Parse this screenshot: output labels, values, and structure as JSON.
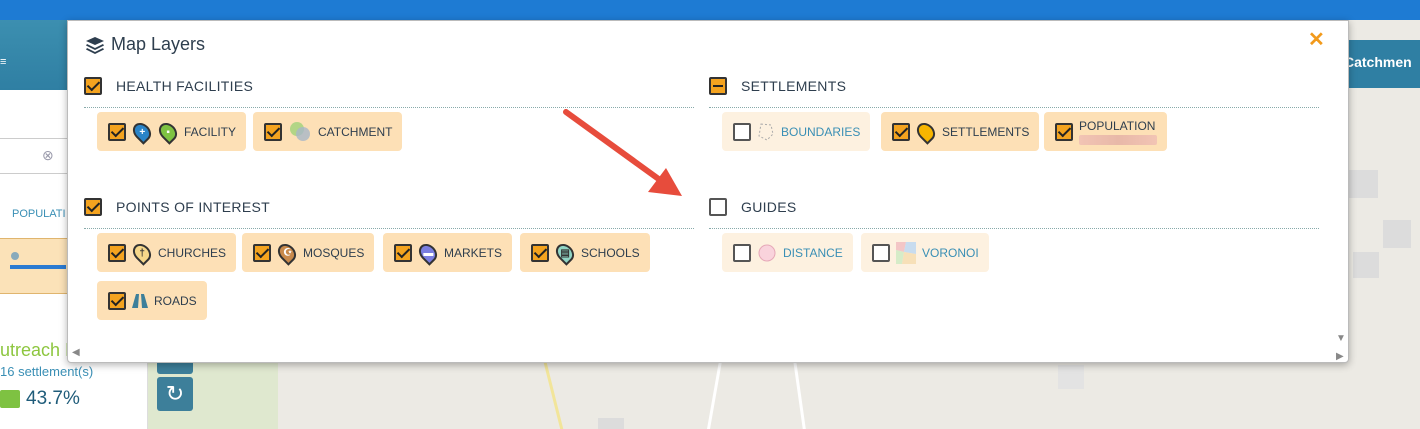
{
  "colors": {
    "accent": "#f4a31f",
    "topbar": "#1e7bd3",
    "arrow": "#e74c3c"
  },
  "background": {
    "right_header": "Catchmen",
    "left_panel": {
      "population_header": "POPULATI",
      "outreach": "utreach I",
      "settlements": "16 settlement(s)",
      "percent": "43.7%"
    }
  },
  "modal": {
    "title": "Map Layers",
    "title_icon": "layers-icon",
    "close_label": "✕",
    "sections": {
      "health": {
        "label": "HEALTH FACILITIES",
        "state": "checked",
        "items": [
          {
            "label": "FACILITY",
            "icon": "facility-pin-icon",
            "checked": true
          },
          {
            "label": "CATCHMENT",
            "icon": "catchment-icon",
            "checked": true
          }
        ]
      },
      "settlements": {
        "label": "SETTLEMENTS",
        "state": "partial",
        "items": [
          {
            "label": "BOUNDARIES",
            "icon": "boundaries-icon",
            "checked": false
          },
          {
            "label": "SETTLEMENTS",
            "icon": "settlement-pin-icon",
            "checked": true
          },
          {
            "label": "POPULATION",
            "icon": "population-gradient",
            "checked": true
          }
        ]
      },
      "poi": {
        "label": "POINTS OF INTEREST",
        "state": "checked",
        "items": [
          {
            "label": "CHURCHES",
            "icon": "church-pin-icon",
            "checked": true
          },
          {
            "label": "MOSQUES",
            "icon": "mosque-pin-icon",
            "checked": true
          },
          {
            "label": "MARKETS",
            "icon": "market-pin-icon",
            "checked": true
          },
          {
            "label": "SCHOOLS",
            "icon": "school-pin-icon",
            "checked": true
          },
          {
            "label": "ROADS",
            "icon": "road-icon",
            "checked": true
          }
        ]
      },
      "guides": {
        "label": "GUIDES",
        "state": "unchecked",
        "items": [
          {
            "label": "DISTANCE",
            "icon": "distance-icon",
            "checked": false
          },
          {
            "label": "VORONOI",
            "icon": "voronoi-icon",
            "checked": false
          }
        ]
      }
    }
  }
}
